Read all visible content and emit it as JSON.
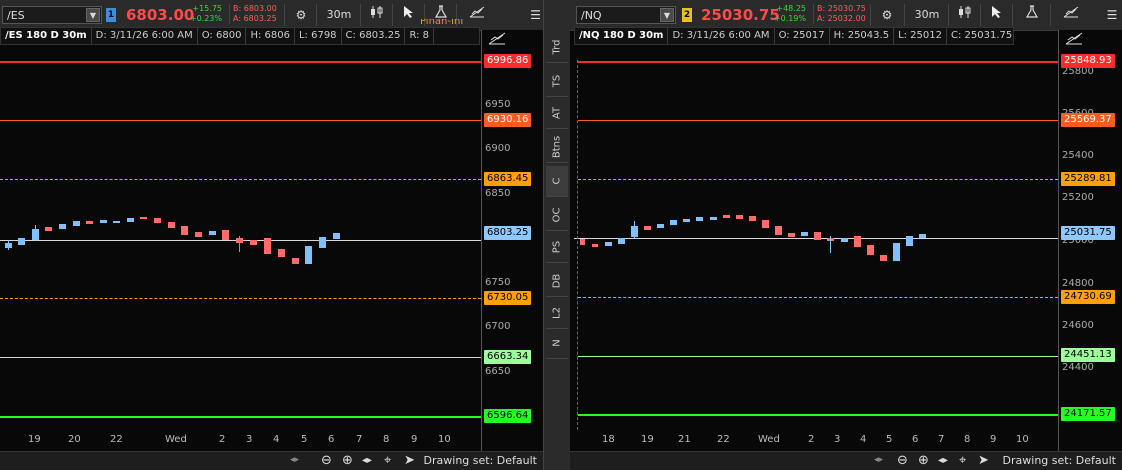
{
  "left": {
    "symbol": "/ES",
    "badge": "1",
    "badge_color": "#3b8ee0",
    "price": "6803.00",
    "change": "+15.75",
    "change_pct": "+0.23%",
    "bid": "B: 6803.00",
    "ask": "A: 6803.25",
    "interval": "30m",
    "info": [
      "/ES 180 D 30m",
      "D: 3/11/26 6:00 AM",
      "O: 6800",
      "H: 6806",
      "L: 6798",
      "C: 6803.25",
      "R: 8"
    ],
    "overlay_text": "Pinan-Inf",
    "y_ticks": [
      "6950",
      "6900",
      "6850",
      "6750",
      "6700",
      "6650"
    ],
    "levels": [
      {
        "label": "6996.86",
        "color": "#ff2a2a",
        "style": "solid"
      },
      {
        "label": "6930.16",
        "color": "#ff5a1f",
        "style": "solid"
      },
      {
        "label": "6863.45",
        "color": "#ffa000",
        "style": "dashed"
      },
      {
        "label": "6803.25",
        "color": "#8fc7ff",
        "style": "solid"
      },
      {
        "label": "6730.05",
        "color": "#ffa000",
        "style": "dashed"
      },
      {
        "label": "6663.34",
        "color": "#9cff9c",
        "style": "solid"
      },
      {
        "label": "6596.64",
        "color": "#22ff22",
        "style": "solid"
      }
    ],
    "x_labels": [
      "19",
      "20",
      "22",
      "Wed",
      "2",
      "3",
      "4",
      "5",
      "6",
      "7",
      "8",
      "9",
      "10"
    ],
    "drawing_set": "Drawing set: Default"
  },
  "right": {
    "symbol": "/NQ",
    "badge": "2",
    "badge_color": "#e8c020",
    "price": "25030.75",
    "change": "+48.25",
    "change_pct": "+0.19%",
    "bid": "B: 25030.75",
    "ask": "A: 25032.00",
    "interval": "30m",
    "info": [
      "/NQ 180 D 30m",
      "D: 3/11/26 6:00 AM",
      "O: 25017",
      "H: 25043.5",
      "L: 25012",
      "C: 25031.75",
      "..."
    ],
    "y_ticks": [
      "25800",
      "25600",
      "25400",
      "25200",
      "25000",
      "24800",
      "24600",
      "24400"
    ],
    "levels": [
      {
        "label": "25848.93",
        "color": "#ff2a2a",
        "style": "solid"
      },
      {
        "label": "25569.37",
        "color": "#ff5a1f",
        "style": "solid"
      },
      {
        "label": "25289.81",
        "color": "#ffa000",
        "style": "dashed"
      },
      {
        "label": "25031.75",
        "color": "#8fc7ff",
        "style": "solid"
      },
      {
        "label": "24730.69",
        "color": "#ffa000",
        "style": "dashed"
      },
      {
        "label": "24451.13",
        "color": "#9cff9c",
        "style": "solid"
      },
      {
        "label": "24171.57",
        "color": "#22ff22",
        "style": "solid"
      }
    ],
    "x_labels": [
      "18",
      "19",
      "21",
      "22",
      "Wed",
      "2",
      "3",
      "4",
      "5",
      "6",
      "7",
      "8",
      "9",
      "10"
    ],
    "drawing_set": "Drawing set: Default"
  },
  "side_tabs": [
    "Trd",
    "TS",
    "AT",
    "Btns",
    "C",
    "OC",
    "PS",
    "DB",
    "L2",
    "N"
  ],
  "side_active": "C",
  "icons": {
    "gear": "gear-icon",
    "candles": "candlestick-style-icon",
    "cursor": "cursor-icon",
    "flask": "studies-flask-icon",
    "drawing": "drawing-tools-icon",
    "menu": "menu-icon"
  }
}
